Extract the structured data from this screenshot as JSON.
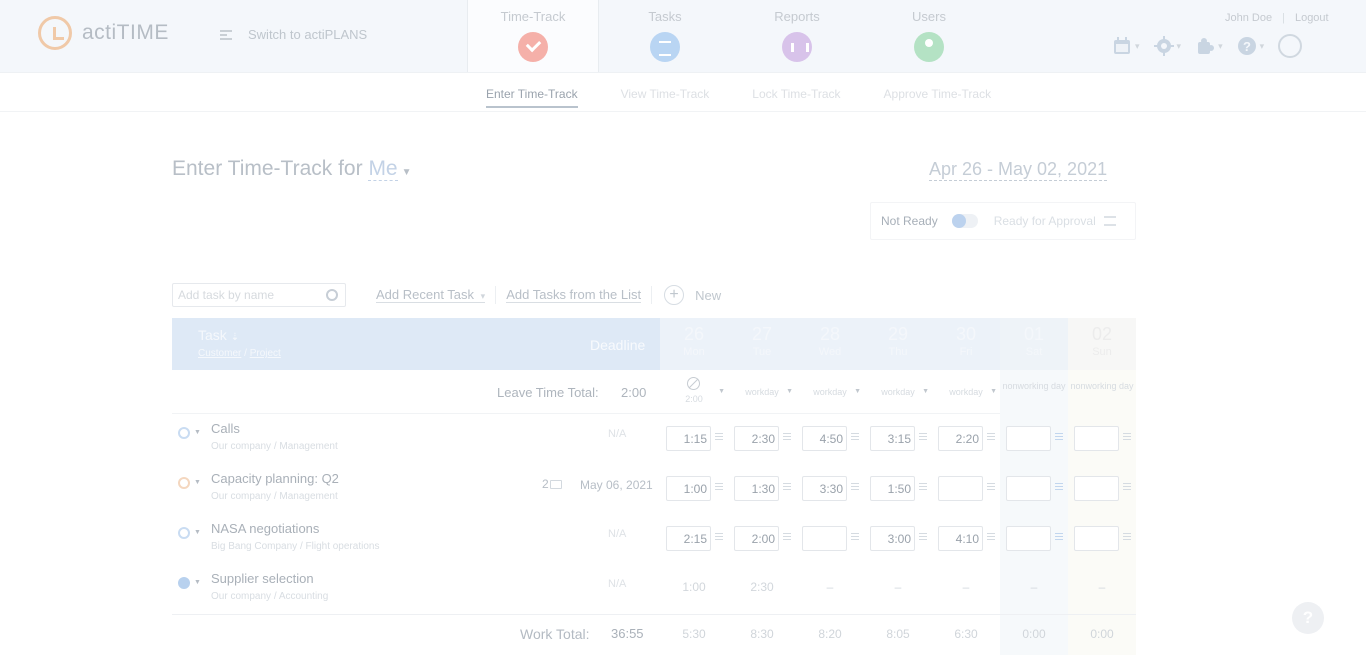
{
  "header": {
    "logo_text": "actiTIME",
    "switch_label": "Switch to actiPLANS",
    "modules": [
      {
        "label": "Time-Track",
        "icon": "checkmark-icon"
      },
      {
        "label": "Tasks",
        "icon": "tasks-list-icon"
      },
      {
        "label": "Reports",
        "icon": "reports-chart-icon"
      },
      {
        "label": "Users",
        "icon": "user-icon"
      }
    ],
    "user_name": "John Doe",
    "logout_label": "Logout",
    "user_sep": "|",
    "help_glyph": "?"
  },
  "subnav": [
    "Enter Time-Track",
    "View Time-Track",
    "Lock Time-Track",
    "Approve Time-Track"
  ],
  "page": {
    "title_prefix": "Enter Time-Track for",
    "title_user": "Me",
    "date_range": "Apr 26 - May 02, 2021",
    "status_not_ready": "Not Ready",
    "status_ready": "Ready for Approval"
  },
  "toolbar": {
    "search_placeholder": "Add task by name",
    "add_recent": "Add Recent Task",
    "add_from_list": "Add Tasks from the List",
    "new_label": "New",
    "plus_glyph": "+"
  },
  "table": {
    "task_header": "Task",
    "sort_arrow": "⇣",
    "customer_label": "Customer",
    "project_label": "Project",
    "path_sep": "/",
    "deadline_header": "Deadline",
    "days": [
      {
        "num": "26",
        "name": "Mon"
      },
      {
        "num": "27",
        "name": "Tue"
      },
      {
        "num": "28",
        "name": "Wed"
      },
      {
        "num": "29",
        "name": "Thu"
      },
      {
        "num": "30",
        "name": "Fri"
      },
      {
        "num": "01",
        "name": "Sat"
      },
      {
        "num": "02",
        "name": "Sun"
      }
    ],
    "leave_label": "Leave Time Total:",
    "leave_total": "2:00",
    "leave_cells": {
      "mon": "2:00",
      "tue": "workday",
      "wed": "workday",
      "thu": "workday",
      "fri": "workday",
      "sat": "nonworking day",
      "sun": "nonworking day"
    },
    "rows": [
      {
        "name": "Calls",
        "customer": "Our company",
        "project": "Management",
        "deadline": "N/A",
        "cells": [
          "1:15",
          "2:30",
          "4:50",
          "3:15",
          "2:20",
          "",
          ""
        ]
      },
      {
        "name": "Capacity planning: Q2",
        "customer": "Our company",
        "project": "Management",
        "comments": "2",
        "deadline": "May 06, 2021",
        "cells": [
          "1:00",
          "1:30",
          "3:30",
          "1:50",
          "",
          "",
          ""
        ]
      },
      {
        "name": "NASA negotiations",
        "customer": "Big Bang Company",
        "project": "Flight operations",
        "deadline": "N/A",
        "cells": [
          "2:15",
          "2:00",
          "",
          "3:00",
          "4:10",
          "",
          ""
        ]
      },
      {
        "name": "Supplier selection",
        "customer": "Our company",
        "project": "Accounting",
        "deadline": "N/A",
        "cells": [
          "1:00",
          "2:30",
          "–",
          "–",
          "–",
          "–",
          "–"
        ]
      }
    ],
    "total_label": "Work Total:",
    "total_value": "36:55",
    "day_totals": [
      "5:30",
      "8:30",
      "8:20",
      "8:05",
      "6:30",
      "0:00",
      "0:00"
    ]
  }
}
